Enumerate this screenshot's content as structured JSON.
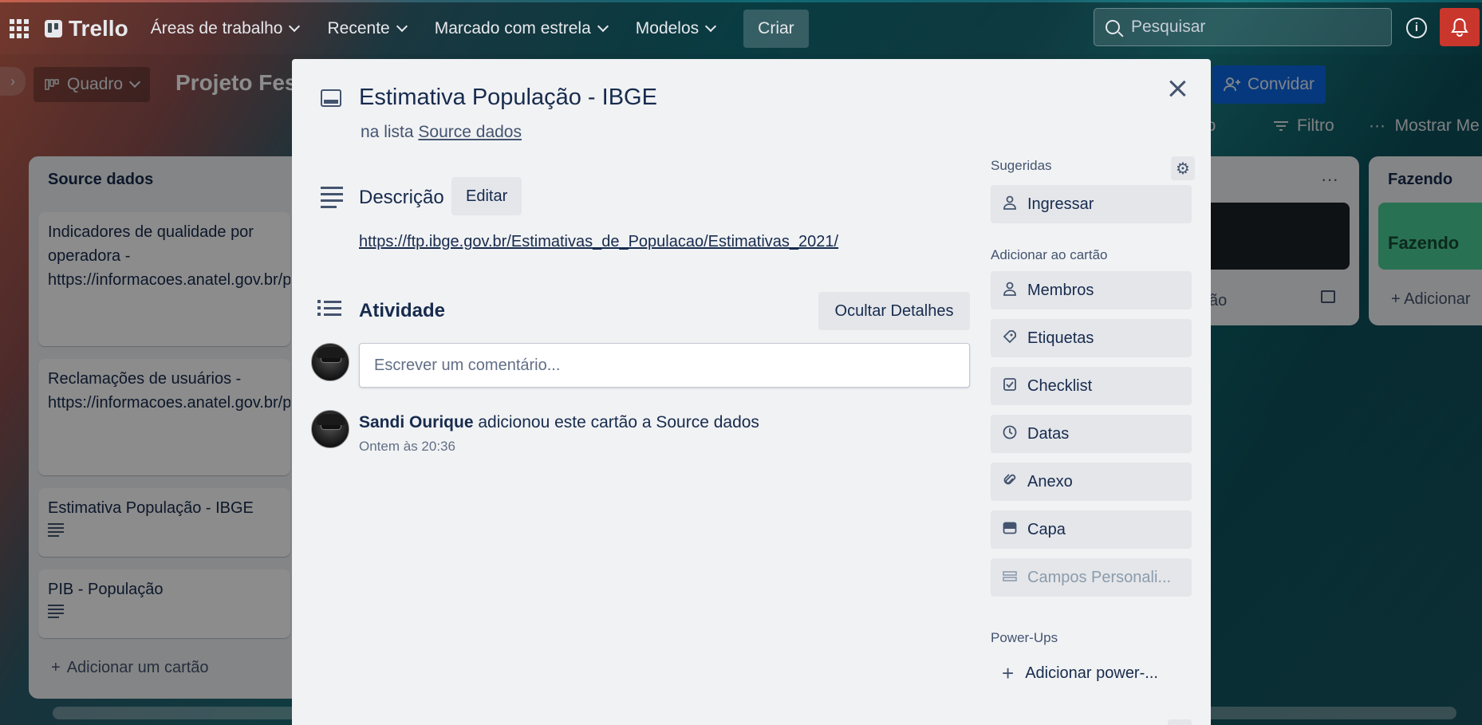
{
  "nav": {
    "brand": "Trello",
    "menus": [
      {
        "label": "Áreas de trabalho"
      },
      {
        "label": "Recente"
      },
      {
        "label": "Marcado com estrela"
      },
      {
        "label": "Modelos"
      }
    ],
    "create_label": "Criar",
    "search_placeholder": "Pesquisar",
    "info_glyph": "i",
    "bell_icon": "bell-icon",
    "notification_color": "#c9372c"
  },
  "board": {
    "view_label": "Quadro",
    "title": "Projeto Fest",
    "invite_label": "Convidar",
    "partial_btn": "io",
    "filter_label": "Filtro",
    "show_menu_label": "Mostrar Me",
    "accent": "#0c66e4"
  },
  "lists": {
    "source": {
      "title": "Source dados",
      "cards": [
        {
          "text": "Indicadores de qualidade por operadora - https://informacoes.anatel.gov.br/paineis/qualidade"
        },
        {
          "text": "Reclamações de usuários - https://informacoes.anatel.gov.br/paineis/consumidor"
        },
        {
          "text": "Estimativa População - IBGE"
        },
        {
          "text": "PIB - População"
        }
      ],
      "add_card_label": "Adicionar um cartão"
    },
    "middle": {
      "menu_glyph": "···",
      "fragment_text": "ão"
    },
    "doing": {
      "title": "Fazendo",
      "card_text": "Fazendo",
      "add_label": "Adicionar",
      "card_color": "#4bce97"
    }
  },
  "modal": {
    "title": "Estimativa População - IBGE",
    "in_list_prefix": "na lista",
    "list_name": "Source dados",
    "description_label": "Descrição",
    "edit_label": "Editar",
    "description_link": "https://ftp.ibge.gov.br/Estimativas_de_Populacao/Estimativas_2021/",
    "activity_label": "Atividade",
    "hide_details_label": "Ocultar Detalhes",
    "comment_placeholder": "Escrever um comentário...",
    "activity": {
      "user": "Sandi Ourique",
      "action": "adicionou este cartão a Source dados",
      "time": "Ontem às 20:36"
    },
    "sidebar": {
      "suggested_label": "Sugeridas",
      "join_label": "Ingressar",
      "add_to_card_label": "Adicionar ao cartão",
      "buttons": [
        {
          "label": "Membros",
          "icon": "person-icon"
        },
        {
          "label": "Etiquetas",
          "icon": "tag-icon"
        },
        {
          "label": "Checklist",
          "icon": "checklist-icon"
        },
        {
          "label": "Datas",
          "icon": "clock-icon"
        },
        {
          "label": "Anexo",
          "icon": "paperclip-icon"
        },
        {
          "label": "Capa",
          "icon": "card-cover-icon"
        },
        {
          "label": "Campos Personali...",
          "icon": "custom-fields-icon",
          "disabled": true
        }
      ],
      "powerups_label": "Power-Ups",
      "add_powerup_label": "Adicionar power-..."
    }
  }
}
